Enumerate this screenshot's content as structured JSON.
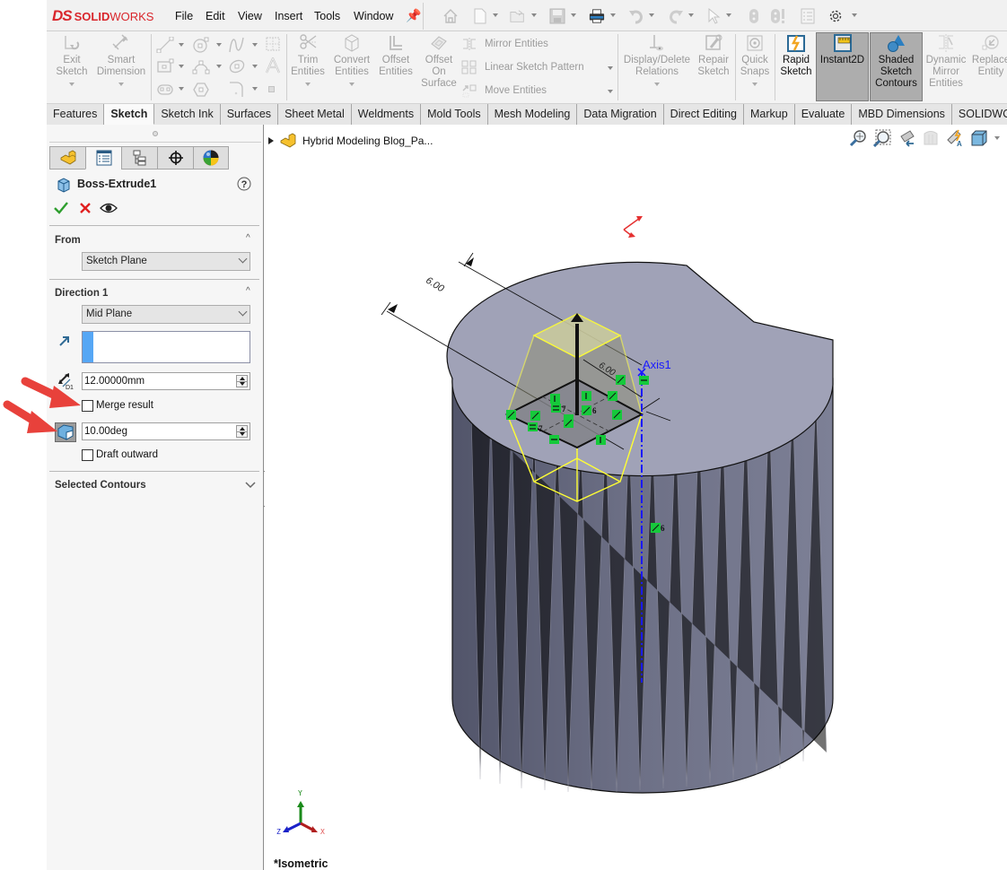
{
  "app": {
    "brand_prefix": "DS",
    "brand_bold": "SOLID",
    "brand_light": "WORKS",
    "brand_color": "#d9262c"
  },
  "menu": [
    "File",
    "Edit",
    "View",
    "Insert",
    "Tools",
    "Window"
  ],
  "quick_access": [
    "home-icon",
    "new-document-icon",
    "open-folder-icon",
    "save-icon",
    "print-icon",
    "undo-icon",
    "redo-icon",
    "select-pointer-icon",
    "rebuild-icon",
    "rebuild-force-icon",
    "file-properties-icon",
    "options-gear-icon"
  ],
  "command_manager": {
    "exit_sketch": "Exit Sketch",
    "smart_dimension": "Smart Dimension",
    "trim_entities": "Trim Entities",
    "convert_entities": "Convert Entities",
    "offset_entities": "Offset Entities",
    "offset_on_surface": "Offset On Surface",
    "mirror_entities": "Mirror Entities",
    "linear_sketch_pattern": "Linear Sketch Pattern",
    "move_entities": "Move Entities",
    "display_delete_relations": "Display/Delete Relations",
    "repair_sketch": "Repair Sketch",
    "quick_snaps": "Quick Snaps",
    "rapid_sketch": "Rapid Sketch",
    "instant2d": "Instant2D",
    "shaded_sketch_contours": "Shaded Sketch Contours",
    "dynamic_mirror_entities": "Dynamic Mirror Entities",
    "replace_entity": "Replace Entity"
  },
  "tabs": [
    {
      "label": "Features",
      "active": false
    },
    {
      "label": "Sketch",
      "active": true
    },
    {
      "label": "Sketch Ink",
      "active": false
    },
    {
      "label": "Surfaces",
      "active": false
    },
    {
      "label": "Sheet Metal",
      "active": false
    },
    {
      "label": "Weldments",
      "active": false
    },
    {
      "label": "Mold Tools",
      "active": false
    },
    {
      "label": "Mesh Modeling",
      "active": false
    },
    {
      "label": "Data Migration",
      "active": false
    },
    {
      "label": "Direct Editing",
      "active": false
    },
    {
      "label": "Markup",
      "active": false
    },
    {
      "label": "Evaluate",
      "active": false
    },
    {
      "label": "MBD Dimensions",
      "active": false
    },
    {
      "label": "SOLIDWORKS A",
      "active": false
    }
  ],
  "property_manager": {
    "title": "Boss-Extrude1",
    "from": {
      "title": "From",
      "value": "Sketch Plane"
    },
    "direction1": {
      "title": "Direction 1",
      "end_condition": "Mid Plane",
      "direction_value": "",
      "depth": "12.00000mm",
      "merge_result_label": "Merge result",
      "merge_result_checked": false,
      "draft_angle": "10.00deg",
      "draft_outward_label": "Draft outward",
      "draft_outward_checked": false
    },
    "selected_contours": {
      "title": "Selected Contours"
    }
  },
  "viewport": {
    "tree_item": "Hybrid Modeling Blog_Pa...",
    "view_orientation": "*Isometric",
    "axis_label": "Axis1",
    "dimension_1": "6.00",
    "dimension_2": "6.00",
    "relation_count_a": "7",
    "relation_count_b": "6",
    "triad": {
      "x": "X",
      "y": "Y",
      "z": "Z"
    }
  },
  "colors": {
    "part_top": "#a1a3b8",
    "part_side": "#6e7187",
    "preview_yellow": "#ffff33",
    "axis_blue": "#1a1aff",
    "relation_green": "#16c93b",
    "annotation_arrow": "#e8413b"
  }
}
